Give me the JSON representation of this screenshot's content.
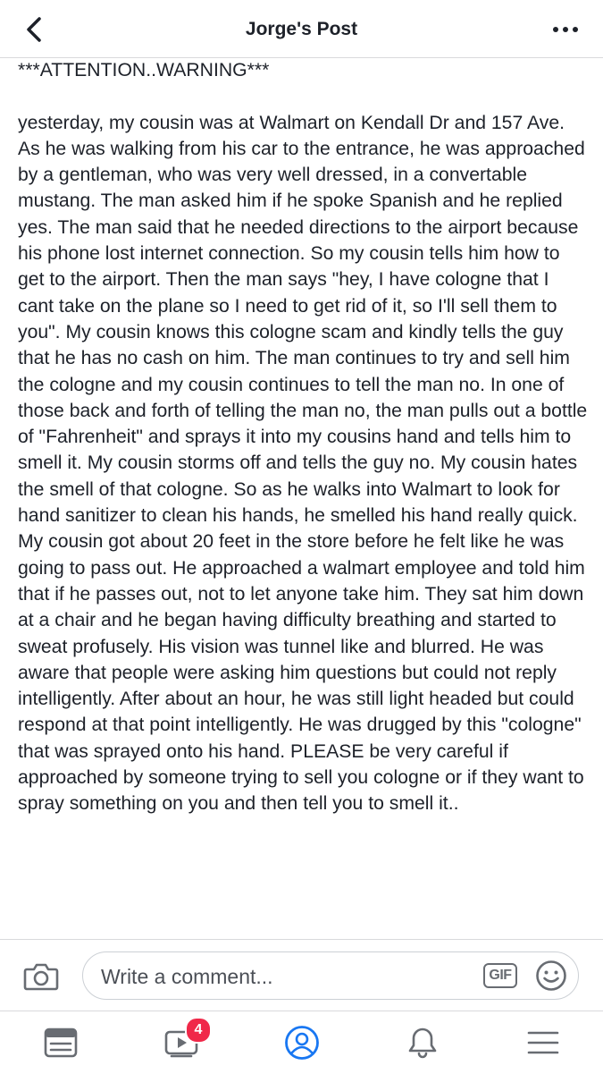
{
  "header": {
    "title": "Jorge's Post",
    "back_icon": "chevron-left-icon",
    "more_icon": "more-dots-icon"
  },
  "post": {
    "attention": "***ATTENTION..WARNING***",
    "text": "yesterday,  my cousin was at Walmart on Kendall Dr and 157 Ave. As he was walking from his car to the entrance, he was approached by a gentleman,  who was very well dressed, in a convertable mustang. The man asked him if he spoke Spanish and he replied yes. The man said that he needed directions to the airport because his phone lost internet connection. So my cousin tells him how to get to the airport. Then the man says \"hey, I have cologne that I cant take on the plane so I need to get rid of it, so I'll sell them to you\". My cousin knows this cologne scam and kindly tells the guy that he has no cash on him. The man continues to try and sell him the cologne and my cousin continues to tell the man no. In one of those back and forth of telling the man no, the man pulls out a bottle of \"Fahrenheit\" and sprays it into my cousins hand and tells him to smell it. My cousin storms off and tells the guy no. My cousin hates the smell of that cologne. So as he walks into Walmart to look for hand sanitizer to clean his hands, he smelled his hand really quick. My cousin got about 20 feet in the store before he felt like he was going to pass out. He approached a walmart employee and told him that if he passes out, not to let anyone take him. They sat him down at a chair and he began having difficulty breathing and started to sweat profusely. His vision was tunnel like and blurred. He was aware that people were asking him questions but could not reply intelligently.  After about an hour, he was still light headed but could respond at that point intelligently. He was drugged by this \"cologne\" that was sprayed onto his hand. PLEASE be very careful if approached by someone trying to sell you cologne or if they want to spray something on you and then tell you to smell it.."
  },
  "comment_bar": {
    "placeholder": "Write a comment...",
    "value": "",
    "gif_label": "GIF",
    "camera_icon": "camera-icon",
    "emoji_icon": "emoji-icon"
  },
  "tab_bar": {
    "tabs": [
      {
        "icon": "news-feed-icon"
      },
      {
        "icon": "watch-video-icon",
        "badge": "4"
      },
      {
        "icon": "profile-icon",
        "active": true
      },
      {
        "icon": "bell-icon"
      },
      {
        "icon": "menu-icon"
      }
    ]
  },
  "colors": {
    "accent": "#1877f2",
    "text": "#1d2129",
    "icon_gray": "#686c72",
    "badge_red": "#f02849",
    "divider": "#d9dadc"
  }
}
